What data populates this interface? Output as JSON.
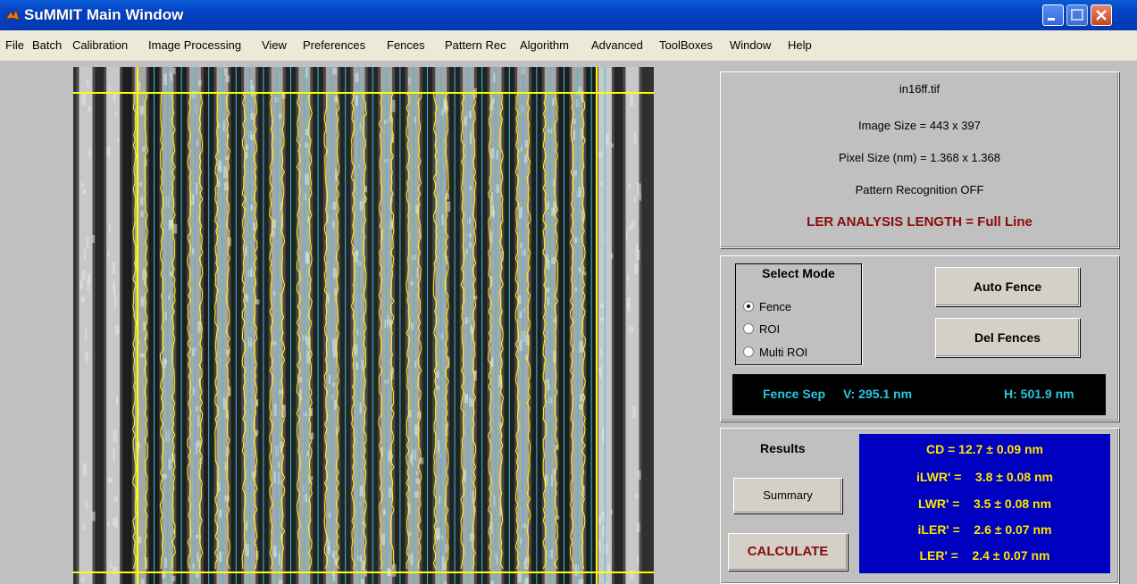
{
  "window": {
    "title": "SuMMIT Main Window",
    "icon": "matlab-icon",
    "controls": [
      "minimize-icon",
      "maximize-icon",
      "close-icon"
    ]
  },
  "menu": [
    "File",
    "Batch",
    "Calibration",
    "Image Processing",
    "View",
    "Preferences",
    "Fences",
    "Pattern Rec",
    "Algorithm",
    "Advanced",
    "ToolBoxes",
    "Window",
    "Help"
  ],
  "image_info": {
    "filename": "in16ff.tif",
    "image_size": "Image Size = 443 x 397",
    "pixel_size": "Pixel Size (nm) = 1.368 x 1.368",
    "pattern_recognition": "Pattern Recognition OFF",
    "ler_length": "LER ANALYSIS LENGTH = Full Line"
  },
  "mode": {
    "title": "Select Mode",
    "options": [
      "Fence",
      "ROI",
      "Multi ROI"
    ],
    "selected": "Fence",
    "auto_fence": "Auto Fence",
    "del_fences": "Del Fences"
  },
  "fence_sep": {
    "label": "Fence Sep",
    "v": "V:  295.1 nm",
    "h": "H:  501.9 nm"
  },
  "results": {
    "label": "Results",
    "summary": "Summary",
    "calculate": "CALCULATE",
    "lines": [
      "CD = 12.7 ± 0.09 nm",
      "iLWR' =    3.8 ± 0.08 nm",
      "LWR' =    3.5 ± 0.08 nm",
      "iLER' =    2.6 ± 0.07 nm",
      "LER' =    2.4 ± 0.07 nm"
    ]
  },
  "colors": {
    "fence": "#ffff00",
    "roi_line": "#25c7e0",
    "results_bg": "#0000c0",
    "results_text": "#ffe600",
    "ler_text": "#8b0a0a"
  }
}
